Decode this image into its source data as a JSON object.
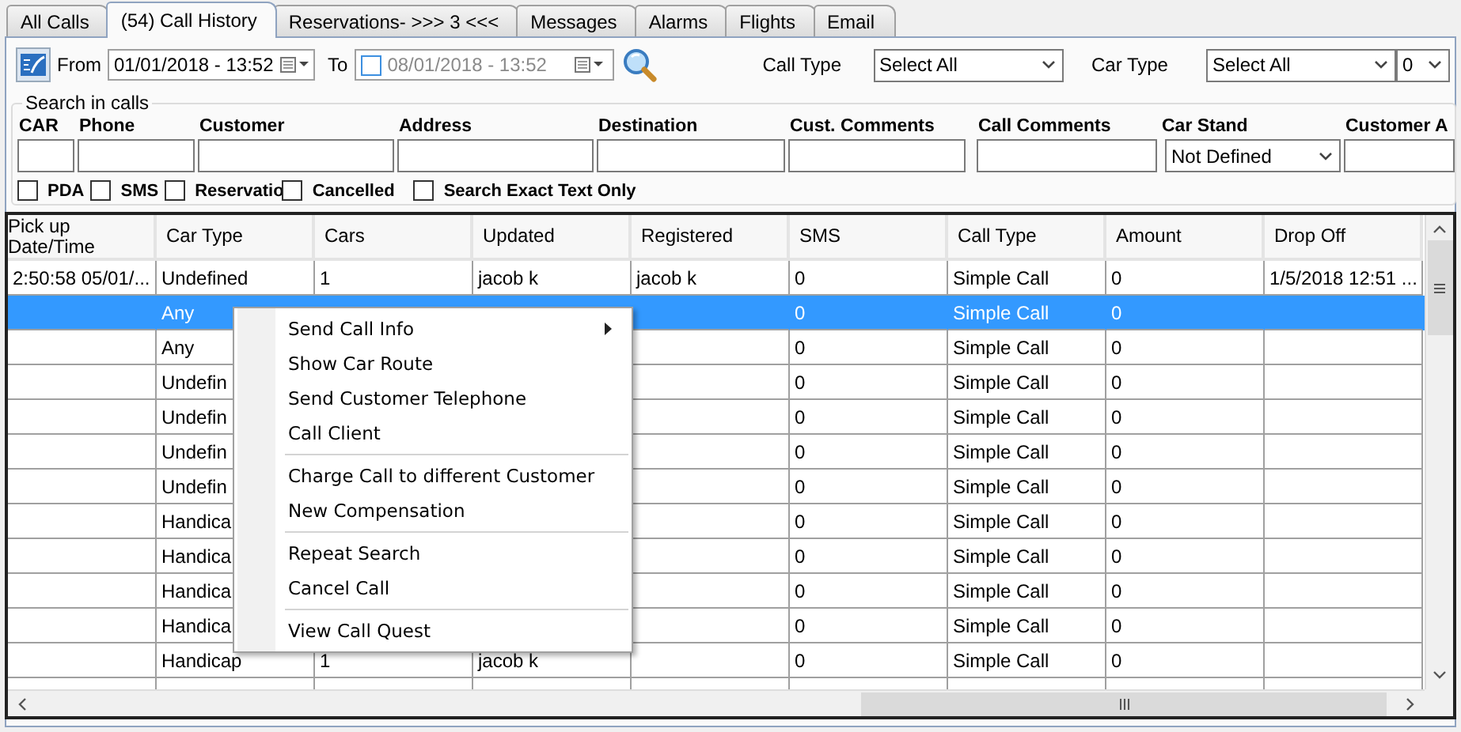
{
  "tabs": [
    {
      "label": "All Calls",
      "selected": false
    },
    {
      "label": "(54) Call History",
      "selected": true
    },
    {
      "label": "Reservations- >>> 3 <<<",
      "selected": false
    },
    {
      "label": "Messages",
      "selected": false
    },
    {
      "label": "Alarms",
      "selected": false
    },
    {
      "label": "Flights",
      "selected": false
    },
    {
      "label": "Email",
      "selected": false
    }
  ],
  "toolbar": {
    "from_label": "From",
    "from_date": "01/01/2018 - 13:52",
    "to_label": "To",
    "to_checked": false,
    "to_date": "08/01/2018 - 13:52",
    "call_type_label": "Call Type",
    "call_type": "Select All",
    "car_type_label": "Car Type",
    "car_type": "Select All",
    "count": "0"
  },
  "search": {
    "title": "Search in calls",
    "fields": [
      {
        "label": "CAR",
        "kind": "text"
      },
      {
        "label": "Phone",
        "kind": "text"
      },
      {
        "label": "Customer",
        "kind": "text"
      },
      {
        "label": "Address",
        "kind": "text"
      },
      {
        "label": "Destination",
        "kind": "text"
      },
      {
        "label": "Cust. Comments",
        "kind": "text"
      },
      {
        "label": "Call Comments",
        "kind": "text"
      },
      {
        "label": "Car Stand",
        "kind": "select",
        "value": "Not Defined"
      },
      {
        "label": "Customer A",
        "kind": "text"
      }
    ],
    "options": [
      {
        "label": "PDA",
        "checked": false
      },
      {
        "label": "SMS",
        "checked": false
      },
      {
        "label": "Reservatio",
        "checked": false
      },
      {
        "label": "Cancelled",
        "checked": false
      },
      {
        "label": "Search Exact Text Only",
        "checked": false
      }
    ]
  },
  "table": {
    "columns": [
      "Pick up Date/Time",
      "Car Type",
      "Cars",
      "Updated",
      "Registered",
      "SMS",
      "Call Type",
      "Amount",
      "Drop Off"
    ],
    "rows": [
      {
        "selected": false,
        "cells": [
          "2:50:58 05/01/...",
          "Undefined",
          "1",
          "jacob k",
          "jacob k",
          "0",
          "Simple Call",
          "0",
          "1/5/2018 12:51 ..."
        ]
      },
      {
        "selected": true,
        "cells": [
          null,
          "Any",
          null,
          null,
          null,
          "0",
          "Simple Call",
          "0",
          null
        ]
      },
      {
        "selected": false,
        "cells": [
          null,
          "Any",
          null,
          null,
          null,
          "0",
          "Simple Call",
          "0",
          null
        ]
      },
      {
        "selected": false,
        "cells": [
          null,
          "Undefin",
          null,
          null,
          null,
          "0",
          "Simple Call",
          "0",
          null
        ]
      },
      {
        "selected": false,
        "cells": [
          null,
          "Undefin",
          null,
          null,
          null,
          "0",
          "Simple Call",
          "0",
          null
        ]
      },
      {
        "selected": false,
        "cells": [
          null,
          "Undefin",
          null,
          null,
          null,
          "0",
          "Simple Call",
          "0",
          null
        ]
      },
      {
        "selected": false,
        "cells": [
          null,
          "Undefin",
          null,
          null,
          null,
          "0",
          "Simple Call",
          "0",
          null
        ]
      },
      {
        "selected": false,
        "cells": [
          null,
          "Handica",
          null,
          null,
          null,
          "0",
          "Simple Call",
          "0",
          null
        ]
      },
      {
        "selected": false,
        "cells": [
          null,
          "Handica",
          null,
          null,
          null,
          "0",
          "Simple Call",
          "0",
          null
        ]
      },
      {
        "selected": false,
        "cells": [
          null,
          "Handica",
          null,
          null,
          null,
          "0",
          "Simple Call",
          "0",
          null
        ]
      },
      {
        "selected": false,
        "cells": [
          null,
          "Handica",
          null,
          null,
          null,
          "0",
          "Simple Call",
          "0",
          null
        ]
      },
      {
        "selected": false,
        "cells": [
          null,
          "Handicap",
          "1",
          "jacob k",
          null,
          "0",
          "Simple Call",
          "0",
          null
        ]
      }
    ]
  },
  "context_menu": {
    "items": [
      {
        "kind": "item",
        "label": "Send Call Info",
        "submenu": true
      },
      {
        "kind": "item",
        "label": "Show Car Route",
        "submenu": false
      },
      {
        "kind": "item",
        "label": "Send Customer Telephone",
        "submenu": false
      },
      {
        "kind": "item",
        "label": "Call Client",
        "submenu": false
      },
      {
        "kind": "separator"
      },
      {
        "kind": "item",
        "label": "Charge Call to different Customer",
        "submenu": false
      },
      {
        "kind": "item",
        "label": "New Compensation",
        "submenu": false
      },
      {
        "kind": "separator"
      },
      {
        "kind": "item",
        "label": "Repeat Search",
        "submenu": false
      },
      {
        "kind": "item",
        "label": "Cancel Call",
        "submenu": false
      },
      {
        "kind": "separator"
      },
      {
        "kind": "item",
        "label": "View Call Quest",
        "submenu": false
      }
    ]
  }
}
